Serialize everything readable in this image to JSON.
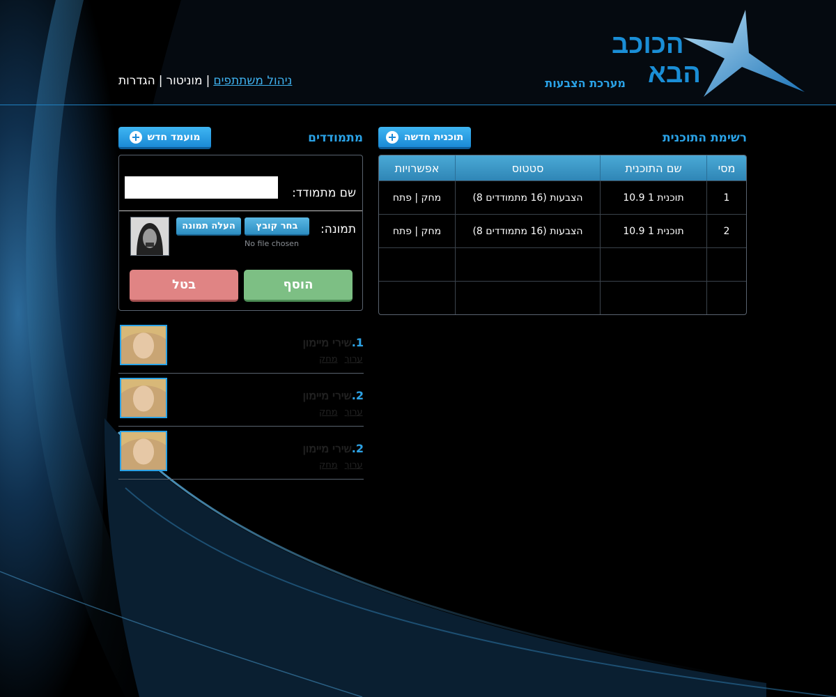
{
  "header": {
    "logo_line1": "הכוכב",
    "logo_line2": "הבא",
    "subtitle": "מערכת הצבעות",
    "nav": {
      "item_active": "ניהול משתתפים",
      "item2": "מוניטור",
      "item3": "הגדרות",
      "separator": "|"
    }
  },
  "programs": {
    "title": "רשימת התוכנית",
    "new_button": "תוכנית חדשה",
    "columns": [
      "מסי",
      "שם התוכנית",
      "סטטוס",
      "אפשרויות"
    ],
    "rows": [
      {
        "num": "1",
        "name": "תוכנית 1 10.9",
        "status": "הצבעות (16 מתמודדים 8)",
        "options": "מחק | פתח"
      },
      {
        "num": "2",
        "name": "תוכנית 1 10.9",
        "status": "הצבעות (16 מתמודדים 8)",
        "options": "מחק | פתח"
      }
    ]
  },
  "contestants": {
    "title": "מתמודדים",
    "new_button": "מועמד חדש",
    "form": {
      "name_label": "שם מתמודד:",
      "name_value": "",
      "photo_label": "תמונה:",
      "choose_file": "בחר קובץ",
      "upload_photo": "העלה תמונה",
      "no_file": "No file chosen",
      "add_button": "הוסף",
      "cancel_button": "בטל"
    },
    "list": [
      {
        "num": "1.",
        "name": "שירי מיימון",
        "edit": "ערוך",
        "delete": "מחק"
      },
      {
        "num": "2.",
        "name": "שירי מיימון",
        "edit": "ערוך",
        "delete": "מחק"
      },
      {
        "num": "2.",
        "name": "שירי מיימון",
        "edit": "ערוך",
        "delete": "מחק"
      }
    ]
  },
  "colors": {
    "accent": "#2aa2e6",
    "add_green": "#7dbf84",
    "cancel_red": "#e08484"
  }
}
